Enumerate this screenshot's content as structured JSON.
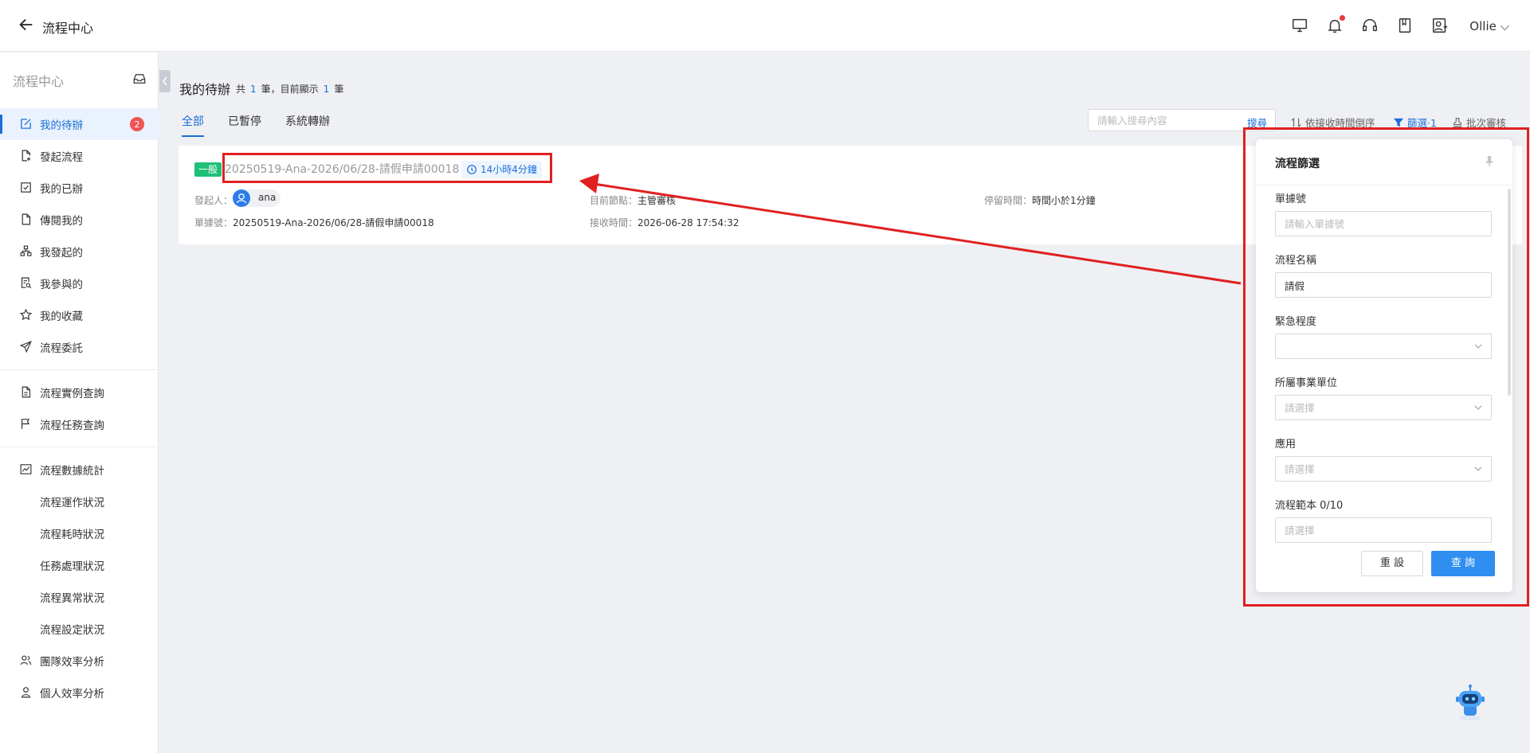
{
  "header": {
    "title": "流程中心",
    "user": "Ollie",
    "icons": [
      "monitor-icon",
      "bell-icon",
      "headset-icon",
      "book-icon",
      "user-switch-icon"
    ]
  },
  "sidebar": {
    "heading": "流程中心",
    "items": [
      {
        "label": "我的待辦",
        "icon": "edit-icon",
        "badge": "2"
      },
      {
        "label": "發起流程",
        "icon": "file-add-icon"
      },
      {
        "label": "我的已辦",
        "icon": "check-square-icon"
      },
      {
        "label": "傳閱我的",
        "icon": "file-icon"
      },
      {
        "label": "我發起的",
        "icon": "org-icon"
      },
      {
        "label": "我參與的",
        "icon": "file-search-icon"
      },
      {
        "label": "我的收藏",
        "icon": "star-icon"
      },
      {
        "label": "流程委託",
        "icon": "send-icon"
      },
      {
        "label": "流程實例查詢",
        "icon": "file-text-icon"
      },
      {
        "label": "流程任務查詢",
        "icon": "flag-icon"
      },
      {
        "label": "流程數據統計",
        "icon": "chart-icon"
      },
      {
        "label": "流程運作狀況"
      },
      {
        "label": "流程耗時狀況"
      },
      {
        "label": "任務處理狀況"
      },
      {
        "label": "流程異常狀況"
      },
      {
        "label": "流程設定狀況"
      },
      {
        "label": "團隊效率分析",
        "icon": "team-icon"
      },
      {
        "label": "個人效率分析",
        "icon": "person-icon"
      }
    ]
  },
  "main": {
    "title": "我的待辦",
    "count_prefix": "共",
    "total": "1",
    "count_mid": "筆，目前顯示",
    "shown": "1",
    "count_suffix": "筆",
    "tabs": [
      "全部",
      "已暫停",
      "系統轉辦"
    ],
    "search_placeholder": "請輸入搜尋內容",
    "search_button": "搜尋",
    "sort_label": "依接收時間倒序",
    "filter_label": "篩選·1",
    "batch_label": "批次審核"
  },
  "task": {
    "tag": "一般",
    "title": "20250519-Ana-2026/06/28-請假申請00018",
    "timer": "14小時4分鐘",
    "initiator_label": "發起人：",
    "initiator": "ana",
    "node_label": "目前節點：",
    "node": "主管審核",
    "stay_label": "停留時間：",
    "stay": "時間小於1分鐘",
    "doc_label": "單據號：",
    "doc": "20250519-Ana-2026/06/28-請假申請00018",
    "recv_label": "接收時間：",
    "recv": "2026-06-28 17:54:32"
  },
  "filter_panel": {
    "title": "流程篩選",
    "doc_no_label": "單據號",
    "doc_no_placeholder": "請輸入單據號",
    "flow_name_label": "流程名稱",
    "flow_name_value": "請假",
    "urgency_label": "緊急程度",
    "unit_label": "所屬事業單位",
    "unit_placeholder": "請選擇",
    "app_label": "應用",
    "app_placeholder": "請選擇",
    "template_label": "流程範本 0/10",
    "template_placeholder": "請選擇",
    "reset": "重 設",
    "query": "查 詢"
  },
  "colors": {
    "accent": "#1a6fd8",
    "badge": "#f05454",
    "tag": "#1fbf77",
    "annotation": "#e02020"
  }
}
